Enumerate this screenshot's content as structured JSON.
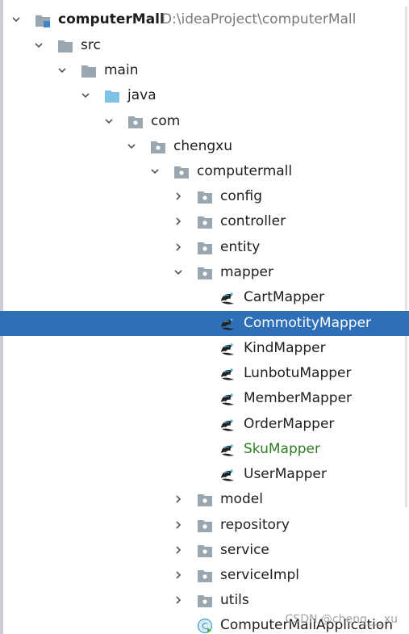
{
  "project": {
    "name": "computerMall",
    "path": "D:\\ideaProject\\computerMall"
  },
  "tree": {
    "src": "src",
    "main": "main",
    "java": "java",
    "com": "com",
    "chengxu": "chengxu",
    "computermall": "computermall",
    "config": "config",
    "controller": "controller",
    "entity": "entity",
    "mapper": "mapper",
    "mappers": [
      "CartMapper",
      "CommotityMapper",
      "KindMapper",
      "LunbotuMapper",
      "MemberMapper",
      "OrderMapper",
      "SkuMapper",
      "UserMapper"
    ],
    "model": "model",
    "repository": "repository",
    "service": "service",
    "serviceImpl": "serviceImpl",
    "utils": "utils",
    "application": "ComputerMallApplication"
  },
  "selected_item": "CommotityMapper",
  "colors": {
    "selection": "#2f6fb8",
    "folder": "#9aa7b0",
    "source_folder": "#7ec3e6",
    "vcs_added": "#2d7c22"
  },
  "icons": {
    "project": "project-module-icon",
    "folder": "folder-icon",
    "source_root": "source-folder-icon",
    "package": "package-icon",
    "mapper": "mybatis-mapper-icon",
    "application": "spring-boot-class-icon"
  },
  "watermark": "CSDN @cheng___xu"
}
